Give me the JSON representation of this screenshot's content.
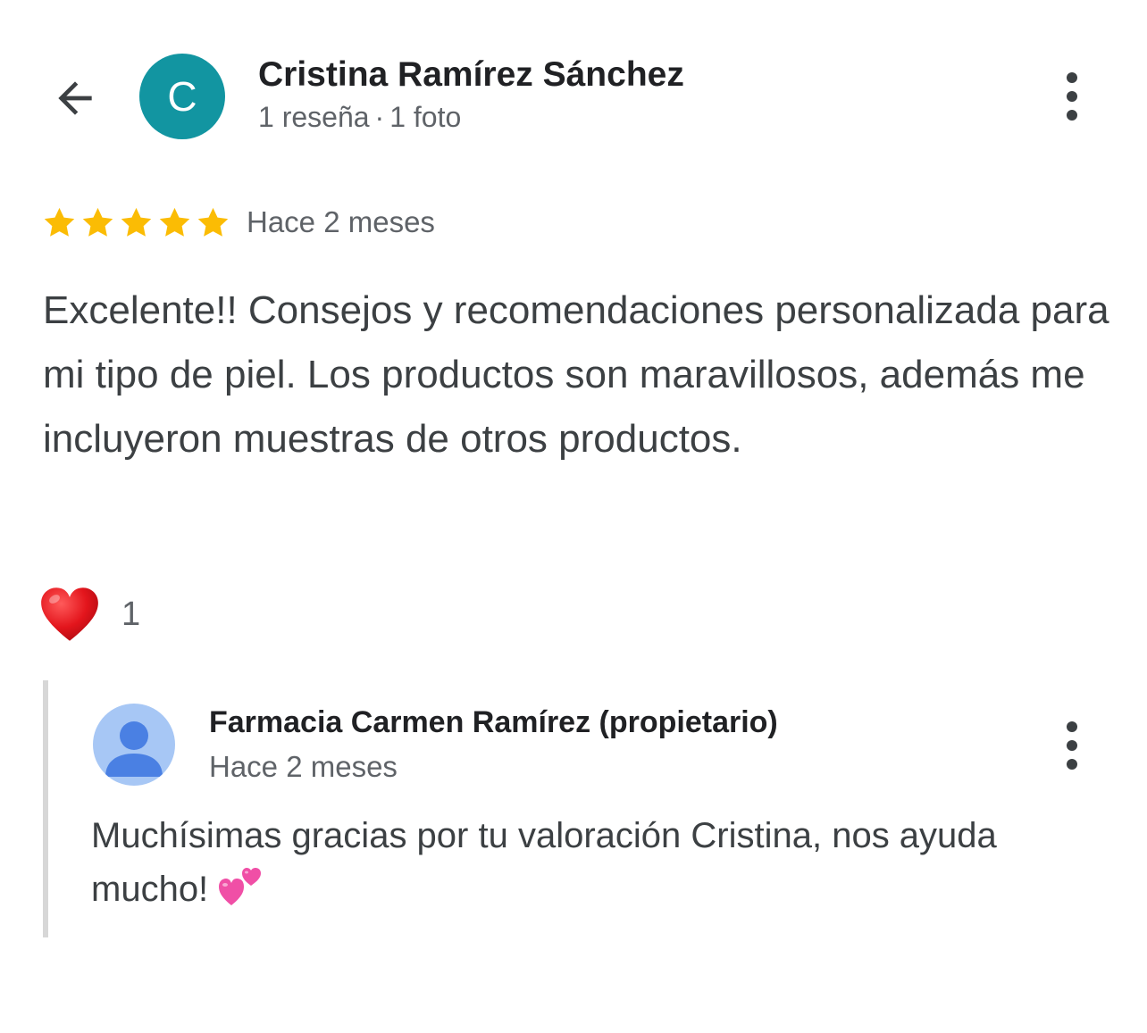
{
  "header": {
    "back_icon": "arrow-back-icon",
    "avatar_letter": "C",
    "avatar_color": "#1295a1",
    "reviewer_name": "Cristina Ramírez Sánchez",
    "reviews_count": "1 reseña",
    "separator": "·",
    "photos_count": "1 foto",
    "menu_icon": "more-vert-icon"
  },
  "rating": {
    "stars": 5,
    "max_stars": 5,
    "star_color": "#fbbc04",
    "time_ago": "Hace 2 meses"
  },
  "review": {
    "text": "Excelente!! Consejos y recomendaciones personalizada para mi tipo de piel. Los productos son maravillosos, además me incluyeron muestras de otros productos."
  },
  "reaction": {
    "icon": "red-heart-icon",
    "count": "1"
  },
  "owner_reply": {
    "avatar_icon": "person-icon",
    "avatar_color": "#a7c7f5",
    "name": "Farmacia Carmen Ramírez (propietario)",
    "time_ago": "Hace 2 meses",
    "text": "Muchísimas gracias por tu valoración Cristina, nos ayuda mucho!",
    "emoji_icon": "two-hearts-icon",
    "menu_icon": "more-vert-icon"
  }
}
